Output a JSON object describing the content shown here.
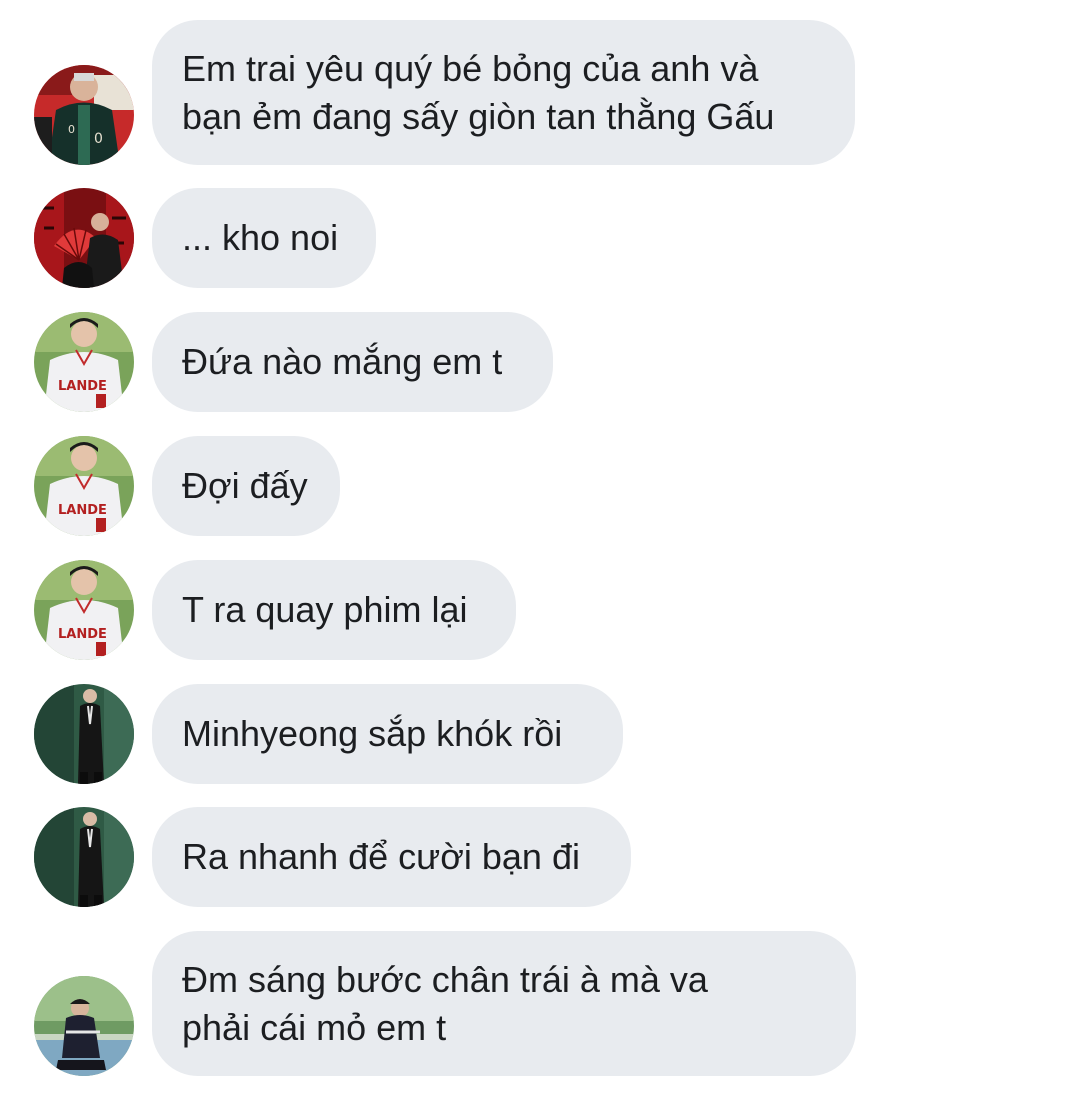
{
  "conversation": {
    "messages": [
      {
        "text": "Em trai yêu quý bé bỏng của anh và\nbạn ẻm đang sấy giòn tan thằng Gấu",
        "avatar": "avatar-jacket-icon"
      },
      {
        "text": "... kho noi",
        "avatar": "avatar-red-fan-icon"
      },
      {
        "text": "Đứa nào mắng em t",
        "avatar": "avatar-baseball-jersey-icon"
      },
      {
        "text": "Đợi đấy",
        "avatar": "avatar-baseball-jersey-icon"
      },
      {
        "text": "T ra quay phim lại",
        "avatar": "avatar-baseball-jersey-icon"
      },
      {
        "text": "Minhyeong sắp khók rồi",
        "avatar": "avatar-black-suit-icon"
      },
      {
        "text": "Ra nhanh để cười bạn đi",
        "avatar": "avatar-black-suit-icon"
      },
      {
        "text": "Đm sáng bước chân trái à mà va\nphải cái mỏ em t",
        "avatar": "avatar-outdoor-crouch-icon"
      }
    ]
  },
  "colors": {
    "bubble_background": "#e8ebef",
    "text": "#1c1e21",
    "page_background": "#ffffff"
  }
}
